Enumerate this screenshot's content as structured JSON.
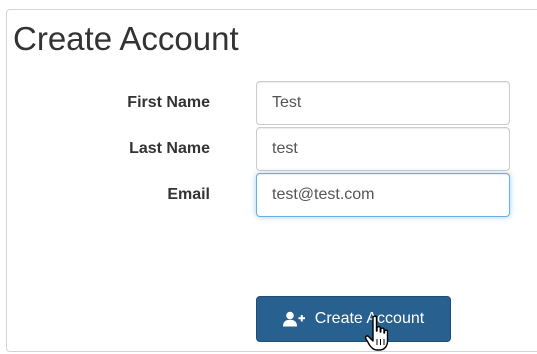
{
  "form": {
    "title": "Create Account",
    "fields": [
      {
        "label": "First Name",
        "value": "Test"
      },
      {
        "label": "Last Name",
        "value": "test"
      },
      {
        "label": "Email",
        "value": "test@test.com"
      }
    ],
    "submit_label": "Create Account",
    "submit_icon": "user-plus-icon"
  },
  "colors": {
    "primary_button": "#286090",
    "focus_border": "#66afe9"
  }
}
